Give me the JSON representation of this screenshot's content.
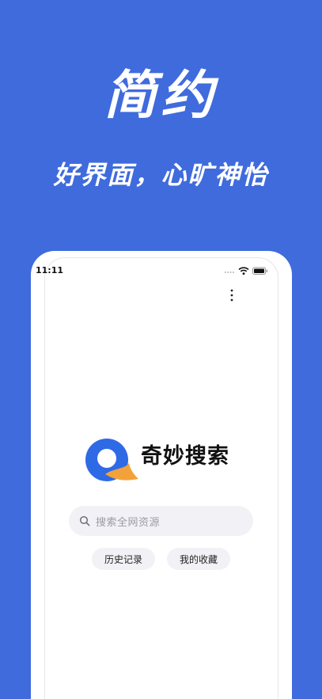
{
  "promo": {
    "headline": "简约",
    "subline": "好界面，心旷神怡"
  },
  "status_bar": {
    "time": "11:11"
  },
  "icons": {
    "signal": "cellular-dots-icon",
    "wifi": "wifi-icon",
    "battery": "battery-icon",
    "menu": "more-vertical-icon",
    "search": "search-icon",
    "logo": "qimiao-logo-icon"
  },
  "app": {
    "name": "奇妙搜索",
    "search_placeholder": "搜索全网资源",
    "chips": [
      {
        "label": "历史记录"
      },
      {
        "label": "我的收藏"
      }
    ]
  },
  "colors": {
    "background": "#3f6bdd",
    "logo_blue": "#2f6ae6",
    "logo_orange": "#f3a23a",
    "search_bg": "#f2f2f6"
  }
}
